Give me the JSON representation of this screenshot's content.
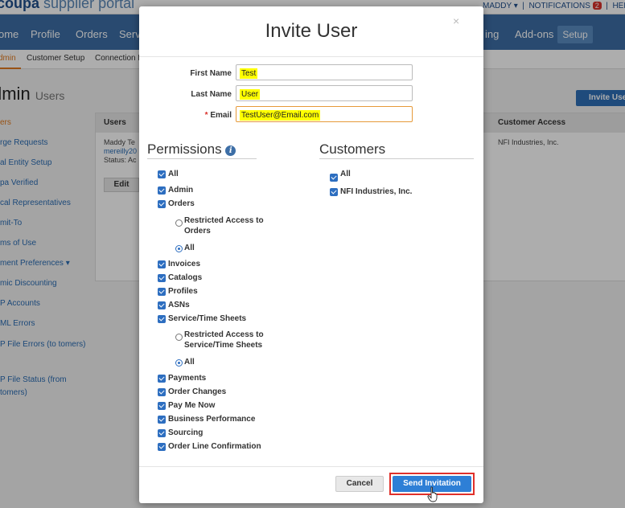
{
  "background": {
    "brand_bold": "coupa",
    "brand_light": "supplier portal",
    "top_right_user": "MADDY ▾",
    "top_right_notifications": "NOTIFICATIONS",
    "notifications_count": "2",
    "top_right_help": "HEL",
    "nav": [
      "ome",
      "Profile",
      "Orders",
      "Serv",
      "ing",
      "Add-ons"
    ],
    "nav_setup": "Setup",
    "subnav": [
      "dmin",
      "Customer Setup",
      "Connection R"
    ],
    "page_title_big": "dmin",
    "page_title_small": "Users",
    "invite_user_button": "Invite User",
    "sidebar": [
      "ers",
      "rge Requests",
      "al Entity Setup",
      "pa Verified",
      "cal Representatives",
      "mit-To",
      "ms of Use",
      "ment Preferences",
      "mic Discounting",
      "P Accounts",
      "ML Errors",
      "P File Errors (to tomers)",
      "P File Status (from tomers)"
    ],
    "table_header_users": "Users",
    "table_header_customer_access": "Customer Access",
    "user_name": "Maddy Te",
    "user_email": "mereilly20",
    "user_status": "Status: Ac",
    "user_customer": "NFI Industries, Inc.",
    "edit_button": "Edit"
  },
  "modal": {
    "title": "Invite User",
    "close_glyph": "×",
    "first_name_label": "First Name",
    "first_name_value": "Test",
    "last_name_label": "Last Name",
    "last_name_value": "User",
    "email_required": "*",
    "email_label": "Email",
    "email_value": "TestUser@Email.com",
    "permissions_title": "Permissions",
    "info_glyph": "i",
    "customers_title": "Customers",
    "permissions": {
      "all": "All",
      "admin": "Admin",
      "orders": "Orders",
      "orders_restricted": "Restricted Access to Orders",
      "orders_all": "All",
      "invoices": "Invoices",
      "catalogs": "Catalogs",
      "profiles": "Profiles",
      "asns": "ASNs",
      "service_time_sheets": "Service/Time Sheets",
      "sts_restricted": "Restricted Access to Service/Time Sheets",
      "sts_all": "All",
      "payments": "Payments",
      "order_changes": "Order Changes",
      "pay_me_now": "Pay Me Now",
      "business_performance": "Business Performance",
      "sourcing": "Sourcing",
      "order_line_confirmation": "Order Line Confirmation"
    },
    "customers": {
      "all": "All",
      "nfi": "NFI Industries, Inc."
    },
    "cancel_label": "Cancel",
    "send_label": "Send Invitation"
  },
  "colors": {
    "accent_blue": "#2e7fd6",
    "nav_blue": "#3d6ea6",
    "highlight": "#ffff00",
    "focus_frame": "#e0302a",
    "active_orange": "#e07a1f"
  }
}
